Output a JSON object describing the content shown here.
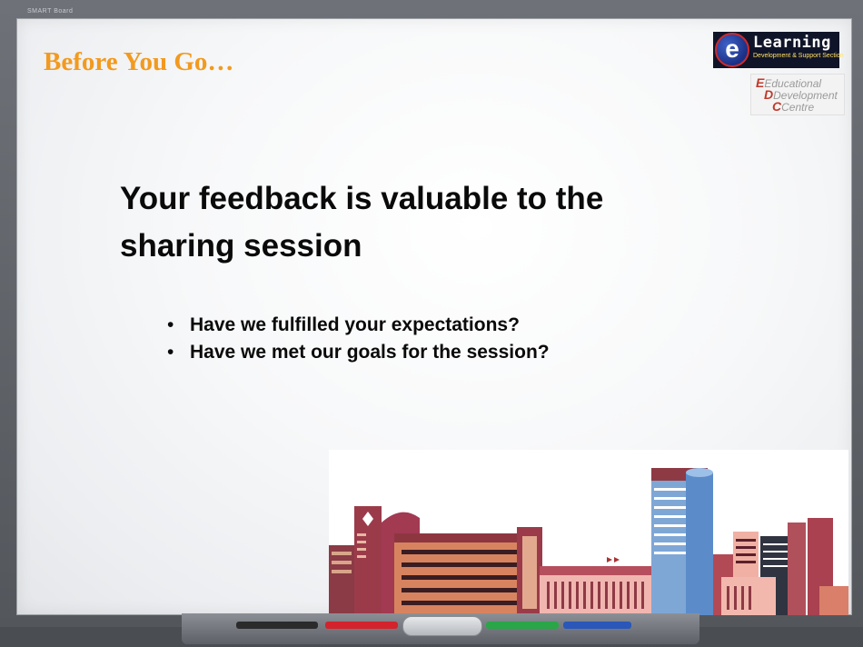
{
  "board": {
    "brand": "SMART Board"
  },
  "slide": {
    "title": "Before You Go…",
    "heading": "Your feedback is valuable to the sharing session",
    "bullets": [
      "Have we fulfilled your expectations?",
      "Have we met our goals for the session?"
    ]
  },
  "logos": {
    "elearning": {
      "letter": "e",
      "word": "Learning",
      "sub": "Development & Support Section"
    },
    "edc": {
      "line1": "Educational",
      "line2": "Development",
      "line3": "Centre"
    }
  },
  "tray": {
    "pens": [
      {
        "name": "black",
        "color": "#2b2b2b"
      },
      {
        "name": "red",
        "color": "#d3232c"
      },
      {
        "name": "green",
        "color": "#2aa548"
      },
      {
        "name": "blue",
        "color": "#2b57b8"
      }
    ]
  },
  "colors": {
    "title": "#f29a1f",
    "text": "#0a0a0a"
  },
  "illustration": "city-skyline-clipart"
}
